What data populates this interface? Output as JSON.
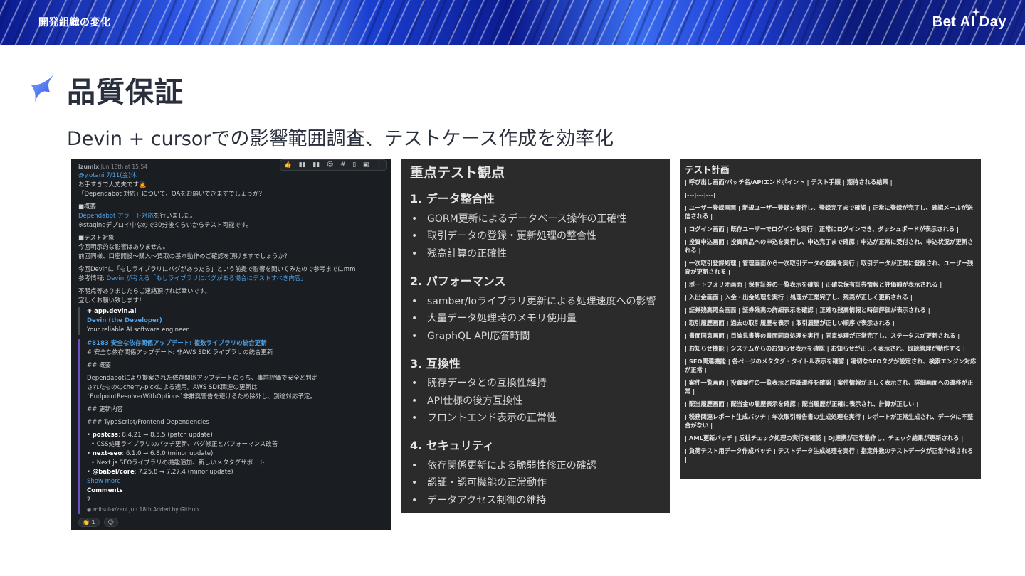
{
  "header": {
    "section": "開発組織の変化",
    "brand": "Bet AI Day"
  },
  "page": {
    "title": "品質保証",
    "subtitle": "Devin + cursorでの影響範囲調査、テストケース作成を効率化"
  },
  "slack": {
    "author": "izumix",
    "timestamp": "Jun 18th at 15:54",
    "mention": "@y.otani 7/11(金)休",
    "lines": [
      "お手すきで大丈夫です🙇",
      "「Dependabot 対応」について、QAをお願いできますでしょうか？"
    ],
    "overview_heading": "■概要",
    "overview_link": "Dependabot アラート対応",
    "overview_suffix": "を行いました。",
    "overview_note": "※stagingデプロイ中なので30分後くらいからテスト可能です。",
    "target_heading": "■テスト対象",
    "target_lines": [
      "今回明示的な影響はありません。",
      "前回同様、口座開設〜購入〜買取の基本動作のご確認を頂けますでしょうか？"
    ],
    "devin_line": "今回Devinに「もしライブラリにバグがあったら」という前提で影響を聞いてみたので参考までにmm",
    "ref_prefix": "参考情報: ",
    "ref_link": "Devin が考える「もしライブラリにバグがある場合にテストすべき内容」",
    "closing_lines": [
      "不明点等ありましたらご連絡頂ければ幸いです。",
      "宜しくお願い致します！"
    ],
    "app_name": "app.devin.ai",
    "app_title": "Devin (the Developer)",
    "app_desc": "Your reliable AI software engineer",
    "pr_title": "#8183 安全な依存関係アップデート: 複数ライブラリの統合更新",
    "pr_lines": [
      "# 安全な依存関係アップデート: 非AWS SDK ライブラリの統合更新",
      "## 概要",
      "Dependabotにより提案された依存関係アップデートのうち、事前評価で安全と判定",
      "されたもののcherry-pickによる適用。AWS SDK関連の更新は",
      "`EndpointResolverWithOptions`非推奨警告を避けるため除外し、別途対応予定。",
      "## 更新内容",
      "### TypeScript/Frontend Dependencies"
    ],
    "deps": [
      {
        "name": "postcss",
        "version": ": 8.4.21 → 8.5.5 (patch update)",
        "note": "CSS処理ライブラリのパッチ更新、バグ修正とパフォーマンス改善"
      },
      {
        "name": "next-seo",
        "version": ": 6.1.0 → 6.8.0 (minor update)",
        "note": "Next.js SEOライブラリの機能追加、新しいメタタグサポート"
      },
      {
        "name": "@babel/core",
        "version": ": 7.25.8 → 7.27.4 (minor update)",
        "note": ""
      }
    ],
    "show_more": "Show more",
    "comments_label": "Comments",
    "comments_count": "2",
    "footer": "mitsui-x/zeni   Jun 18th   Added by GitHub",
    "reaction_count": "1"
  },
  "viewpoints": {
    "title": "重点テスト観点",
    "sections": [
      {
        "heading": "1. データ整合性",
        "items": [
          "GORM更新によるデータベース操作の正確性",
          "取引データの登録・更新処理の整合性",
          "残高計算の正確性"
        ]
      },
      {
        "heading": "2. パフォーマンス",
        "items": [
          "samber/loライブラリ更新による処理速度への影響",
          "大量データ処理時のメモリ使用量",
          "GraphQL API応答時間"
        ]
      },
      {
        "heading": "3. 互換性",
        "items": [
          "既存データとの互換性維持",
          "API仕様の後方互換性",
          "フロントエンド表示の正常性"
        ]
      },
      {
        "heading": "4. セキュリティ",
        "items": [
          "依存関係更新による脆弱性修正の確認",
          "認証・認可機能の正常動作",
          "データアクセス制御の維持"
        ]
      }
    ]
  },
  "plan": {
    "title": "テスト計画",
    "rows": [
      "| 呼び出し画面/バッチ名/APIエンドポイント | テスト手順 | 期待される結果 |",
      "|---|---|---|",
      "| ユーザー登録画面 | 新規ユーザー登録を実行し、登録完了まで確認 | 正常に登録が完了し、確認メールが送信される |",
      "| ログイン画面 | 既存ユーザーでログインを実行 | 正常にログインでき、ダッシュボードが表示される |",
      "| 投資申込画面 | 投資商品への申込を実行し、申込完了まで確認 | 申込が正常に受付され、申込状況が更新される |",
      "| 一次取引登録処理 | 管理画面から一次取引データの登録を実行 | 取引データが正常に登録され、ユーザー残高が更新される |",
      "| ポートフォリオ画面 | 保有証券の一覧表示を確認 | 正確な保有証券情報と評価額が表示される |",
      "| 入出金画面 | 入金・出金処理を実行 | 処理が正常完了し、残高が正しく更新される |",
      "| 証券残高照会画面 | 証券残高の詳細表示を確認 | 正確な残高情報と時価評価が表示される |",
      "| 取引履歴画面 | 過去の取引履歴を表示 | 取引履歴が正しい順序で表示される |",
      "| 書面同意画面 | 目論見書等の書面同意処理を実行 | 同意処理が正常完了し、ステータスが更新される |",
      "| お知らせ機能 | システムからのお知らせ表示を確認 | お知らせが正しく表示され、既読管理が動作する |",
      "| SEO関連機能 | 各ページのメタタグ・タイトル表示を確認 | 適切なSEOタグが設定され、検索エンジン対応が正常 |",
      "| 案件一覧画面 | 投資案件の一覧表示と詳細遷移を確認 | 案件情報が正しく表示され、詳細画面への遷移が正常 |",
      "| 配当履歴画面 | 配当金の履歴表示を確認 | 配当履歴が正確に表示され、計算が正しい |",
      "| 税務関連レポート生成バッチ | 年次取引報告書の生成処理を実行 | レポートが正常生成され、データに不整合がない |",
      "| AML更新バッチ | 反社チェック処理の実行を確認 | DJ連携が正常動作し、チェック結果が更新される |",
      "| 負荷テスト用データ作成バッチ | テストデータ生成処理を実行 | 指定件数のテストデータが正常作成される |"
    ]
  }
}
